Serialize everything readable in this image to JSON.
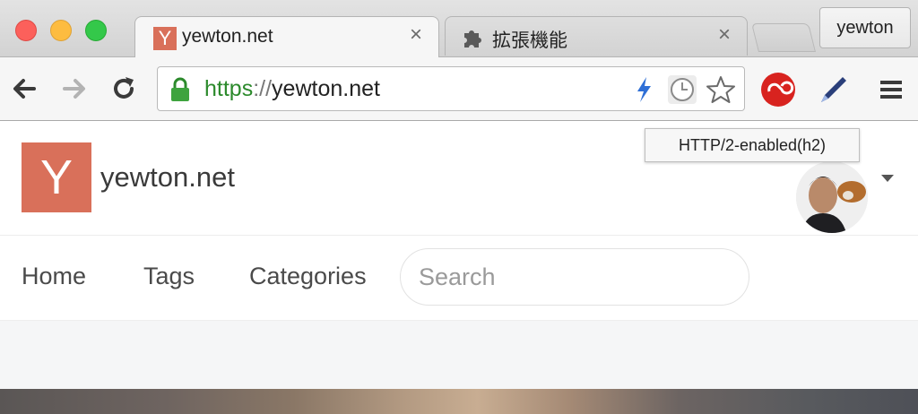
{
  "browser": {
    "tabs": [
      {
        "title": "yewton.net",
        "favicon_letter": "Y",
        "icon": "site-favicon",
        "active": true
      },
      {
        "title": "拡張機能",
        "icon": "puzzle-icon",
        "active": false
      }
    ],
    "profile_name": "yewton",
    "address": {
      "scheme": "https",
      "separator": "://",
      "host": "yewton.net"
    },
    "tooltip": "HTTP/2-enabled(h2)"
  },
  "site": {
    "logo_letter": "Y",
    "title": "yewton.net",
    "nav": [
      "Home",
      "Tags",
      "Categories"
    ],
    "search_placeholder": "Search"
  },
  "colors": {
    "brand": "#d9705a",
    "secure_green": "#2c8a2c",
    "http2_bolt": "#2f6fd6"
  }
}
